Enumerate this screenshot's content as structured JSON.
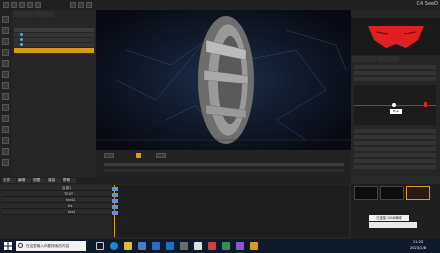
{
  "app": {
    "title": "CG Geek",
    "brand": "C4 SeeD"
  },
  "viewport": {
    "stats": "FPS:58.43  888806  GPU:37% Mem:321130/9088",
    "camera": "Camera 1"
  },
  "tools": {
    "tooltip": "Sounde"
  },
  "right_panel": {
    "tag": "Eye",
    "label": "Track"
  },
  "timeline": {
    "layers": [
      "合成1",
      "TEXT",
      "text1",
      "ttt",
      "text"
    ]
  },
  "menu": {
    "labels": [
      "文件",
      "编辑",
      "视图",
      "渲染",
      "帮助"
    ]
  },
  "popup": {
    "label": "已连接  2/0/8局域"
  },
  "taskbar": {
    "search_label": "在这里输入你要搜索的内容",
    "clock_time": "11:23",
    "clock_date": "2023/1/8"
  },
  "colors": {
    "accent": "#d89a1a",
    "red_mask": "#e02020",
    "taskbar": "#0f1a2a"
  },
  "icons": [
    "windows-icon",
    "search-icon",
    "task-view-icon",
    "edge-icon",
    "folder-icon",
    "store-icon",
    "mail-icon",
    "app-icon"
  ]
}
